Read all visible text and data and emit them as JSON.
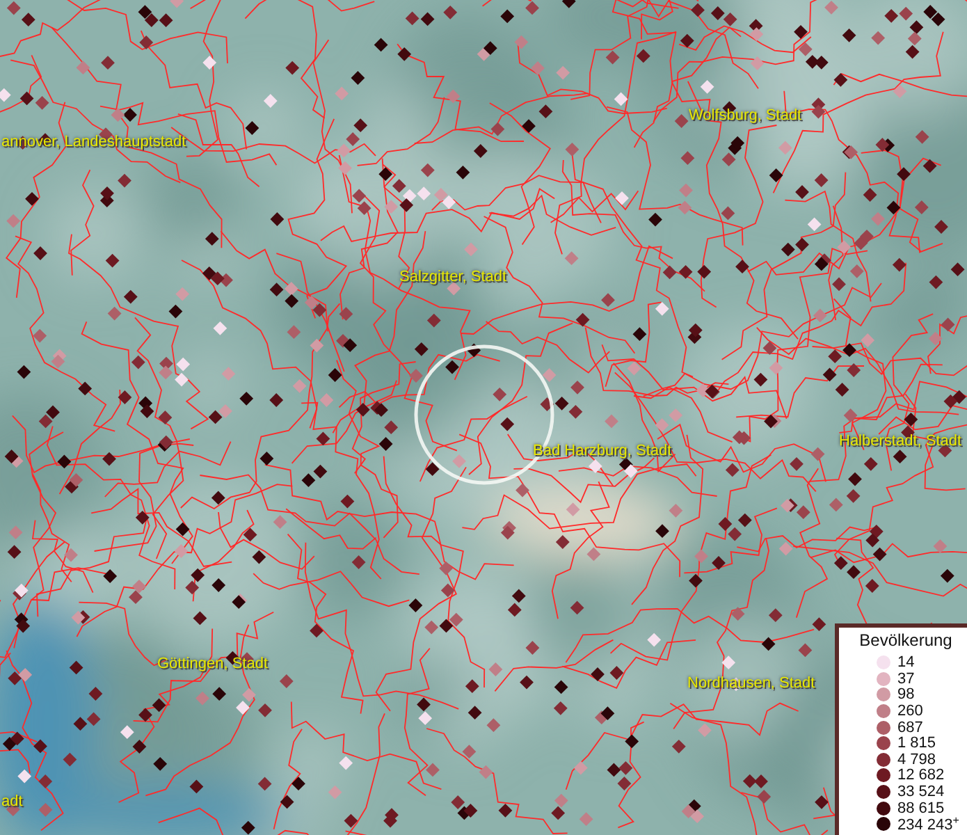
{
  "map": {
    "place_labels": [
      {
        "text": "annover, Landeshauptstadt"
      },
      {
        "text": "Wolfsburg, Stadt"
      },
      {
        "text": "Salzgitter, Stadt"
      },
      {
        "text": "Bad Harzburg, Stadt"
      },
      {
        "text": "Halberstadt, Stadt"
      },
      {
        "text": "Göttingen, Stadt"
      },
      {
        "text": "Nordhausen, Stadt"
      },
      {
        "text": "adt"
      }
    ]
  },
  "legend": {
    "title": "Bevölkerung",
    "items": [
      {
        "label": "14",
        "color": "#f5e1ee"
      },
      {
        "label": "37",
        "color": "#e2b4c0"
      },
      {
        "label": "98",
        "color": "#d19ba4"
      },
      {
        "label": "260",
        "color": "#c07f88"
      },
      {
        "label": "687",
        "color": "#ad5f67"
      },
      {
        "label": "1 815",
        "color": "#9a434c"
      },
      {
        "label": "4 798",
        "color": "#832c35"
      },
      {
        "label": "12 682",
        "color": "#6e1a22"
      },
      {
        "label": "33 524",
        "color": "#571017"
      },
      {
        "label": "88 615",
        "color": "#420a0f"
      },
      {
        "label": "234 243$^{+}$",
        "color": "#2a0508"
      }
    ]
  }
}
